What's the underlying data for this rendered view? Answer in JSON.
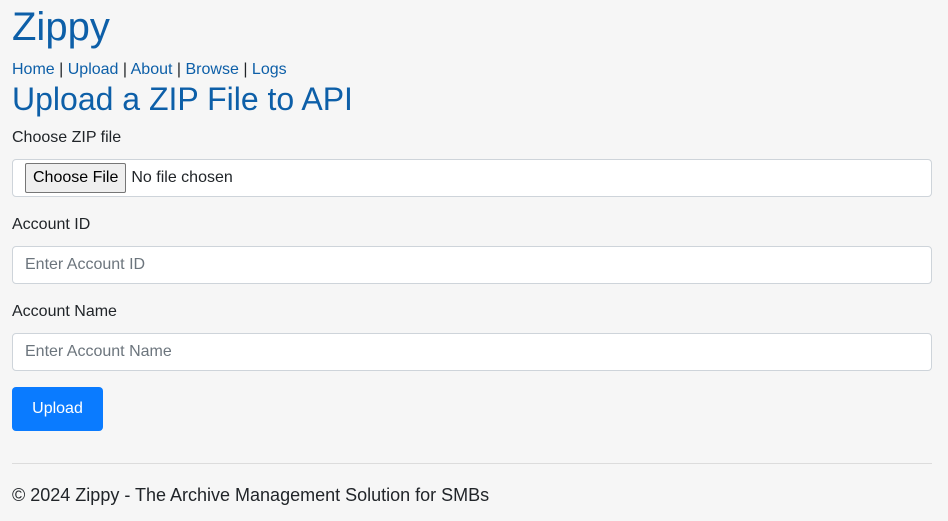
{
  "site": {
    "title": "Zippy"
  },
  "nav": {
    "items": [
      {
        "label": "Home"
      },
      {
        "label": "Upload"
      },
      {
        "label": "About"
      },
      {
        "label": "Browse"
      },
      {
        "label": "Logs"
      }
    ],
    "separator": "|"
  },
  "main": {
    "heading": "Upload a ZIP File to API",
    "zip_field": {
      "label": "Choose ZIP file",
      "button_label": "Choose File",
      "status": "No file chosen"
    },
    "account_id_field": {
      "label": "Account ID",
      "value": "",
      "placeholder": "Enter Account ID"
    },
    "account_name_field": {
      "label": "Account Name",
      "value": "",
      "placeholder": "Enter Account Name"
    },
    "submit_label": "Upload"
  },
  "footer": {
    "text": "© 2024 Zippy - The Archive Management Solution for SMBs"
  },
  "colors": {
    "link": "#0d5fa8",
    "primary_button": "#0a7bff",
    "background": "#f6f6f6"
  }
}
